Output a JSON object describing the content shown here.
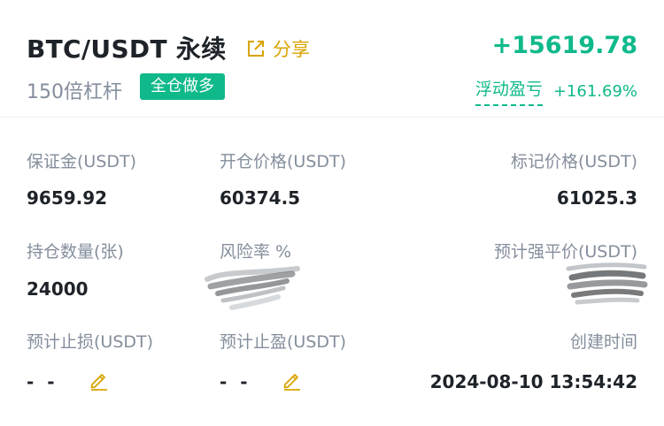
{
  "header": {
    "symbol": "BTC/USDT 永续",
    "share_label": "分享",
    "leverage": "150倍杠杆",
    "margin_mode": "全仓做多",
    "pnl_value": "+15619.78",
    "pnl_label": "浮动盈亏",
    "pnl_percent": "+161.69%"
  },
  "fields": {
    "margin": {
      "label": "保证金(USDT)",
      "value": "9659.92"
    },
    "entry_price": {
      "label": "开仓价格(USDT)",
      "value": "60374.5"
    },
    "mark_price": {
      "label": "标记价格(USDT)",
      "value": "61025.3"
    },
    "quantity": {
      "label": "持仓数量(张)",
      "value": "24000"
    },
    "risk_rate": {
      "label": "风险率 %"
    },
    "liq_price": {
      "label": "预计强平价(USDT)"
    },
    "stop_loss": {
      "label": "预计止损(USDT)",
      "value": "- -"
    },
    "take_profit": {
      "label": "预计止盈(USDT)",
      "value": "- -"
    },
    "created_time": {
      "label": "创建时间",
      "value": "2024-08-10 13:54:42"
    }
  },
  "colors": {
    "accent_green": "#0fb98a",
    "accent_gold": "#d8a400",
    "text_primary": "#1e2329",
    "text_secondary": "#848e9c"
  },
  "icons": {
    "share": "share-icon",
    "edit": "pencil-icon"
  }
}
